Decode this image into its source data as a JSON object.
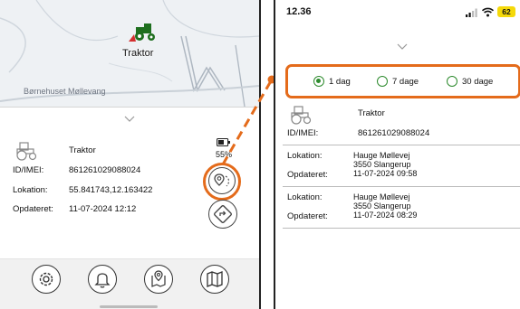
{
  "left_screen": {
    "map": {
      "vehicle_label": "Traktor",
      "place_label": "Børnehuset Møllevang"
    },
    "vehicle": {
      "name": "Traktor",
      "id_label": "ID/IMEI:",
      "id_value": "861261029088024",
      "location_label": "Lokation:",
      "location_value": "55.841743,12.163422",
      "updated_label": "Opdateret:",
      "updated_value": "11-07-2024 12:12"
    },
    "battery_percent": "55%",
    "actions": [
      "location-history",
      "directions"
    ],
    "bottom_nav": [
      "settings",
      "alerts",
      "geofence",
      "map"
    ]
  },
  "right_screen": {
    "status_bar": {
      "time": "12.36",
      "battery": "62"
    },
    "period_options": [
      {
        "label": "1 dag",
        "selected": true
      },
      {
        "label": "7 dage",
        "selected": false
      },
      {
        "label": "30 dage",
        "selected": false
      }
    ],
    "vehicle": {
      "name": "Traktor",
      "id_label": "ID/IMEI:",
      "id_value": "861261029088024"
    },
    "history": [
      {
        "location_label": "Lokation:",
        "address_line1": "Hauge Møllevej",
        "address_line2": "3550 Slangerup",
        "updated_label": "Opdateret:",
        "updated_value": "11-07-2024 09:58"
      },
      {
        "location_label": "Lokation:",
        "address_line1": "Hauge Møllevej",
        "address_line2": "3550 Slangerup",
        "updated_label": "Opdateret:",
        "updated_value": "11-07-2024 08:29"
      }
    ]
  },
  "colors": {
    "highlight": "#e46b1b",
    "radio_green": "#2e8b2e",
    "marker_green": "#1e6f1e",
    "battery_yellow": "#f5d90a"
  }
}
